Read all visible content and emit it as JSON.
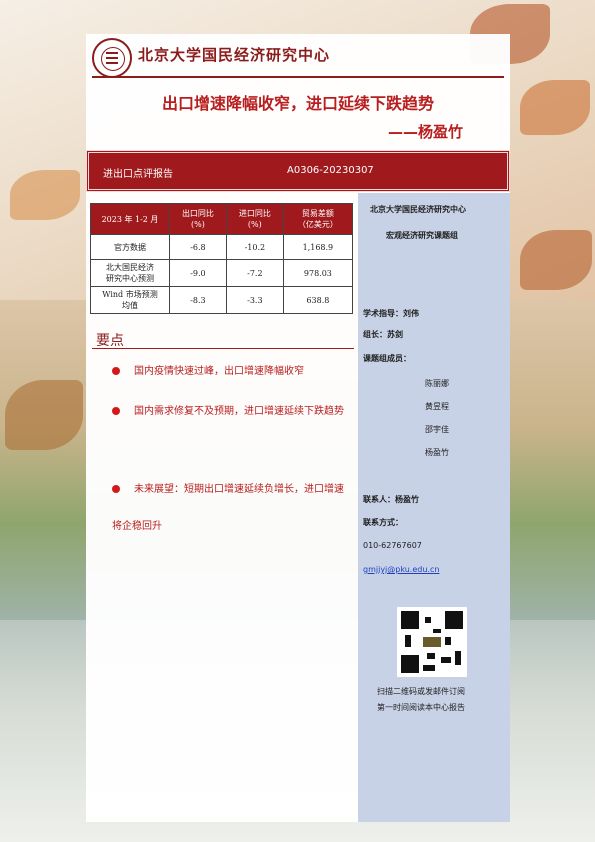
{
  "header": {
    "org_name": "北京大学国民经济研究中心"
  },
  "title": "出口增速降幅收窄，进口延续下跌趋势",
  "author": "——杨盈竹",
  "report_bar": {
    "type": "进出口点评报告",
    "code": "A0306-20230307"
  },
  "table": {
    "headers": [
      "2023 年 1-2 月",
      "出口同比\n(%)",
      "进口同比\n(%)",
      "贸易差额\n（亿美元）"
    ],
    "rows": [
      [
        "官方数据",
        "-6.8",
        "-10.2",
        "1,168.9"
      ],
      [
        "北大国民经济\n研究中心预测",
        "-9.0",
        "-7.2",
        "978.03"
      ],
      [
        "Wind 市场预测\n均值",
        "-8.3",
        "-3.3",
        "638.8"
      ]
    ]
  },
  "key_points": {
    "title": "要点",
    "items": [
      "国内疫情快速过峰，出口增速降幅收窄",
      "国内需求修复不及预期，进口增速延续下跌趋势",
      "未来展望：短期出口增速延续负增长，进口增速将企稳回升"
    ]
  },
  "sidebar": {
    "org": "北京大学国民经济研究中心",
    "group": "宏观经济研究课题组",
    "advisor": "学术指导：刘伟",
    "leader": "组长：苏剑",
    "members_label": "课题组成员：",
    "members": [
      "陈丽娜",
      "黄昱程",
      "邵宇佳",
      "杨盈竹"
    ],
    "contact_person": "联系人：杨盈竹",
    "contact_label": "联系方式：",
    "phone": "010-62767607",
    "email": "gmjjyj@pku.edu.cn",
    "qr_caption_1": "扫描二维码或发邮件订阅",
    "qr_caption_2": "第一时间阅读本中心报告"
  },
  "colors": {
    "brand_red": "#a0191d",
    "title_red": "#b81e1e",
    "sidebar_blue": "#c8d2e6"
  }
}
